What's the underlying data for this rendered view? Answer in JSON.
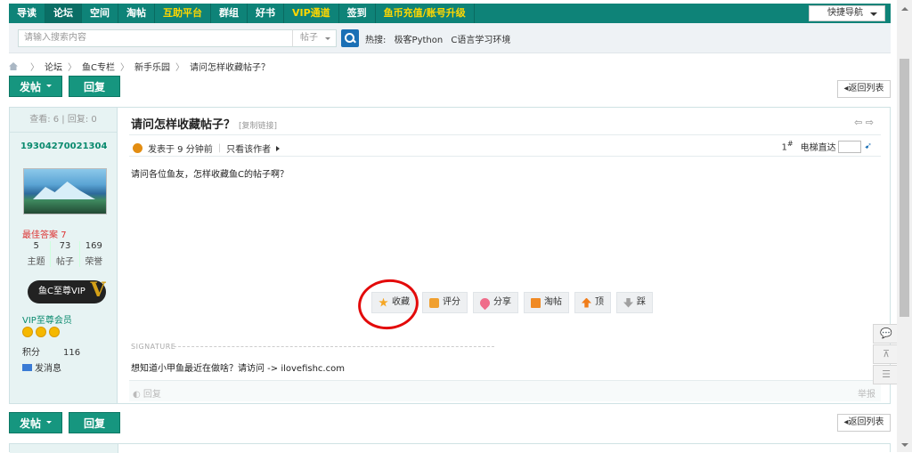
{
  "topnav": {
    "items": [
      {
        "label": "导读",
        "active": false
      },
      {
        "label": "论坛",
        "active": true
      },
      {
        "label": "空间",
        "active": false
      },
      {
        "label": "淘帖",
        "active": false
      },
      {
        "label": "互助平台",
        "active": false,
        "highlight": true
      },
      {
        "label": "群组",
        "active": false
      },
      {
        "label": "好书",
        "active": false
      },
      {
        "label": "VIP通道",
        "active": false,
        "highlight": true
      },
      {
        "label": "签到",
        "active": false
      },
      {
        "label": "鱼币充值/账号升级",
        "active": false,
        "highlight": true
      }
    ],
    "quick_nav": "快捷导航"
  },
  "search": {
    "placeholder": "请输入搜索内容",
    "type_select": "帖子",
    "hot_label": "热搜:",
    "hot_terms": [
      "极客Python",
      "C语言学习环境"
    ]
  },
  "breadcrumb": [
    "论坛",
    "鱼C专栏",
    "新手乐园",
    "请问怎样收藏帖子？"
  ],
  "buttons": {
    "post": "发帖",
    "reply": "回复",
    "back_to_list": "◂返回列表"
  },
  "author": {
    "stats": "查看: 6 | 回复: 0",
    "name": "19304270021304",
    "best_answer_label": "最佳答案",
    "best_answer_count": "7",
    "counts": [
      {
        "value": "5",
        "label": "主题"
      },
      {
        "value": "73",
        "label": "帖子"
      },
      {
        "value": "169",
        "label": "荣誉"
      }
    ],
    "vip_badge": "鱼C至尊VIP",
    "vip_title": "VIP至尊会员",
    "score_label": "积分",
    "score_value": "116",
    "send_message": "发消息"
  },
  "post": {
    "title": "请问怎样收藏帖子？",
    "copy_link": "[复制链接]",
    "posted": "发表于 9 分钟前",
    "author_only": "只看该作者",
    "floor": "1",
    "floor_suffix": "#",
    "jump_label": "电梯直达",
    "body": "请问各位鱼友，怎样收藏鱼C的帖子啊？",
    "actions": [
      {
        "label": "收藏",
        "icon": "star-icon",
        "color": "#f5a623"
      },
      {
        "label": "评分",
        "icon": "thumb-icon",
        "color": "#f0a030"
      },
      {
        "label": "分享",
        "icon": "heart-icon",
        "color": "#ef6d8a"
      },
      {
        "label": "淘帖",
        "icon": "box-icon",
        "color": "#f08a24"
      },
      {
        "label": "顶",
        "icon": "arrow-up-icon",
        "color": "#f07d1a"
      },
      {
        "label": "踩",
        "icon": "arrow-down-icon",
        "color": "#a0a0a0"
      }
    ],
    "signature_label": "SIGNATURE",
    "signature": "想知道小甲鱼最近在做啥？请访问 -> ilovefishc.com",
    "reply_link": "回复",
    "report_link": "举报"
  },
  "float_tools": [
    "💬",
    "⊼",
    "☰"
  ],
  "colors": {
    "nav_bg": "#0e8378",
    "button_bg": "#16967f",
    "highlight_circle": "#e30a0a",
    "author_name": "#0a8a6e"
  }
}
